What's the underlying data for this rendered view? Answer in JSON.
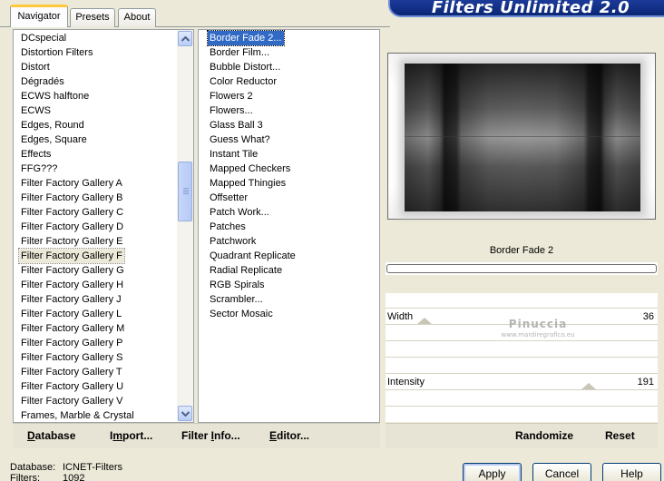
{
  "window": {
    "title": "Filters Unlimited 2.0"
  },
  "tabs": [
    {
      "label": "Navigator",
      "active": true
    },
    {
      "label": "Presets",
      "active": false
    },
    {
      "label": "About",
      "active": false
    }
  ],
  "categories": [
    "DCspecial",
    "Distortion Filters",
    "Distort",
    "Dégradés",
    "ECWS halftone",
    "ECWS",
    "Edges, Round",
    "Edges, Square",
    "Effects",
    "FFG???",
    "Filter Factory Gallery A",
    "Filter Factory Gallery B",
    "Filter Factory Gallery C",
    "Filter Factory Gallery D",
    "Filter Factory Gallery E",
    "Filter Factory Gallery F",
    "Filter Factory Gallery G",
    "Filter Factory Gallery H",
    "Filter Factory Gallery J",
    "Filter Factory Gallery L",
    "Filter Factory Gallery M",
    "Filter Factory Gallery P",
    "Filter Factory Gallery S",
    "Filter Factory Gallery T",
    "Filter Factory Gallery U",
    "Filter Factory Gallery V",
    "Frames, Marble & Crystal"
  ],
  "selected_category_index": 15,
  "filters": [
    "Border Fade 2...",
    "Border Film...",
    "Bubble Distort...",
    "Color Reductor",
    "Flowers 2",
    "Flowers...",
    "Glass Ball 3",
    "Guess What?",
    "Instant Tile",
    "Mapped Checkers",
    "Mapped Thingies",
    "Offsetter",
    "Patch Work...",
    "Patches",
    "Patchwork",
    "Quadrant Replicate",
    "Radial Replicate",
    "RGB Spirals",
    "Scrambler...",
    "Sector Mosaic"
  ],
  "selected_filter_index": 0,
  "preview": {
    "filter_name": "Border Fade 2"
  },
  "params": [
    {
      "label": "Width",
      "value": "36",
      "slider_fraction": 0.14
    },
    {
      "label": "Intensity",
      "value": "191",
      "slider_fraction": 0.75
    }
  ],
  "watermark": {
    "line1": "Pinuccia",
    "line2": "www.mardiregrafico.eu"
  },
  "toolbar": {
    "database": {
      "ul": "D",
      "rest": "atabase"
    },
    "import": {
      "pre": "I",
      "ul": "m",
      "rest": "port..."
    },
    "filter_info": {
      "pre": "Filter ",
      "ul": "I",
      "rest": "nfo..."
    },
    "editor": {
      "ul": "E",
      "rest": "ditor..."
    },
    "randomize": "Randomize",
    "reset": "Reset"
  },
  "status": {
    "database_label": "Database:",
    "database_value": "ICNET-Filters",
    "filters_label": "Filters:",
    "filters_value": "1092"
  },
  "buttons": {
    "apply": "Apply",
    "cancel": "Cancel",
    "help": "Help"
  },
  "colors": {
    "selection": "#316ac5",
    "banner": "#0a2775",
    "tab_accent": "#ffc83c"
  }
}
